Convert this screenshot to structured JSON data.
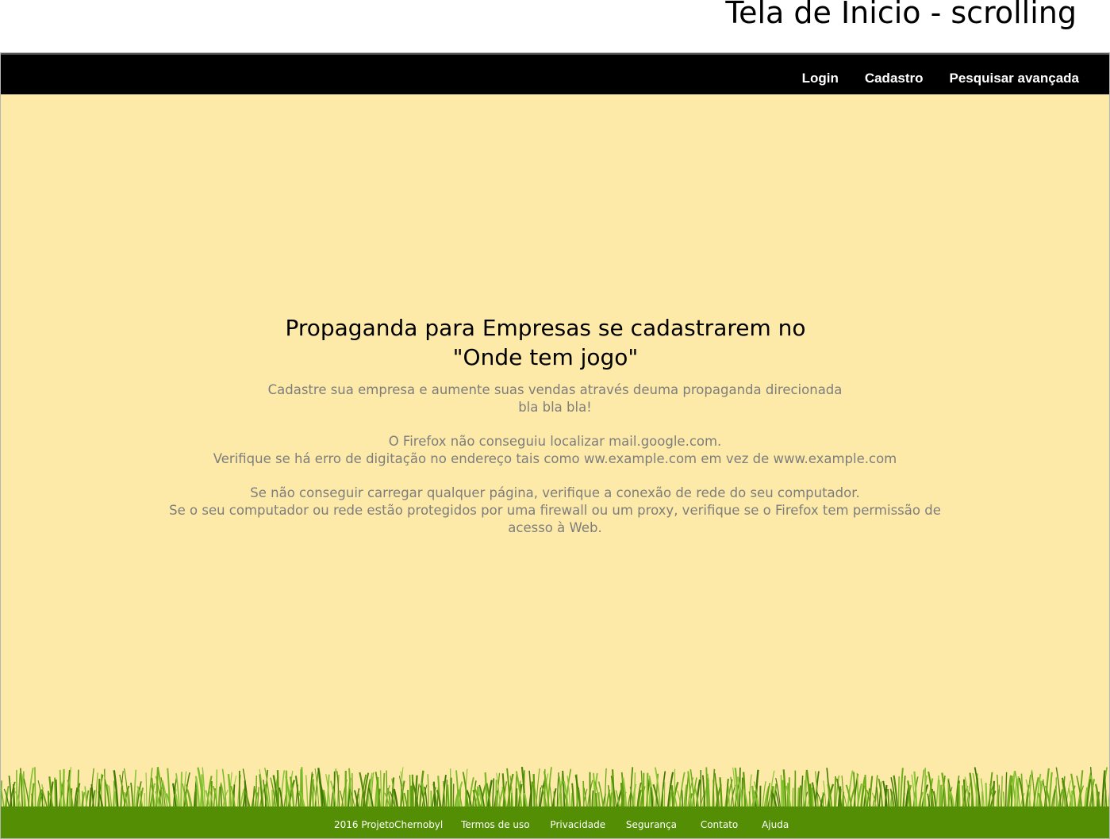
{
  "header": {
    "title": "Tela de Inicio - scrolling"
  },
  "nav": {
    "login": "Login",
    "cadastro": "Cadastro",
    "pesquisar": "Pesquisar avançada"
  },
  "main": {
    "title_line1": "Propaganda para Empresas se cadastrarem no",
    "title_line2": "\"Onde tem jogo\"",
    "lines": [
      "Cadastre sua empresa e aumente suas vendas através deuma propaganda direcionada",
      "bla bla bla!",
      "O Firefox não conseguiu localizar mail.google.com.",
      "Verifique se há erro de digitação no endereço tais como  ww.example.com em vez de  www.example.com",
      "Se não conseguir carregar qualquer página, verifique a conexão de rede  do seu computador.",
      "Se o seu computador ou rede estão protegidos por uma firewall ou um proxy, verifique se o Firefox tem permissão de",
      "acesso à Web."
    ]
  },
  "footer": {
    "copyright": "2016 ProjetoChernobyl",
    "terms": "Termos de uso",
    "privacy": "Privacidade",
    "security": "Segurança",
    "contact": "Contato",
    "help": "Ajuda"
  },
  "colors": {
    "background": "#feeaa8",
    "navbar": "#000000",
    "footer": "#548e04",
    "body_text": "#7d7d7d"
  }
}
